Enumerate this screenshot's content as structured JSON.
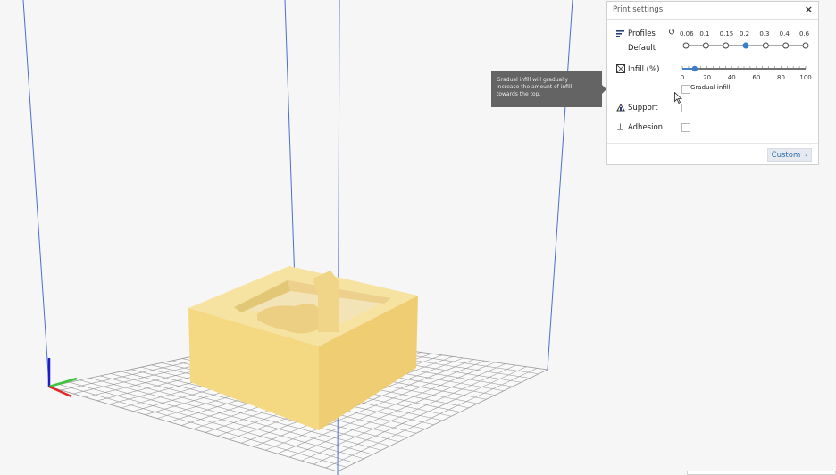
{
  "panel": {
    "title": "Print settings",
    "close": "×",
    "profiles": {
      "label": "Profiles",
      "value": "Default",
      "reset_icon": "reset-icon",
      "ticks": [
        "0.06",
        "0.1",
        "0.15",
        "0.2",
        "0.3",
        "0.4",
        "0.6"
      ],
      "selected": "0.2"
    },
    "infill": {
      "label": "Infill (%)",
      "ticks": [
        "0",
        "20",
        "40",
        "60",
        "80",
        "100"
      ],
      "value": 10,
      "gradual_label": "Gradual infill"
    },
    "support": {
      "label": "Support"
    },
    "adhesion": {
      "label": "Adhesion"
    },
    "custom_label": "Custom",
    "custom_chevron": "›"
  },
  "tooltip": {
    "lines": [
      "Gradual infill will gradually",
      "increase the amount of infill",
      "towards the top."
    ]
  },
  "colors": {
    "accent": "#3b7dc8",
    "model": "#f3d98a",
    "grid": "#9a9a9a",
    "build_volume": "#4a6fd1",
    "axis_x": "#e02a2a",
    "axis_y": "#3cc43c",
    "axis_z": "#1c1cc8"
  }
}
